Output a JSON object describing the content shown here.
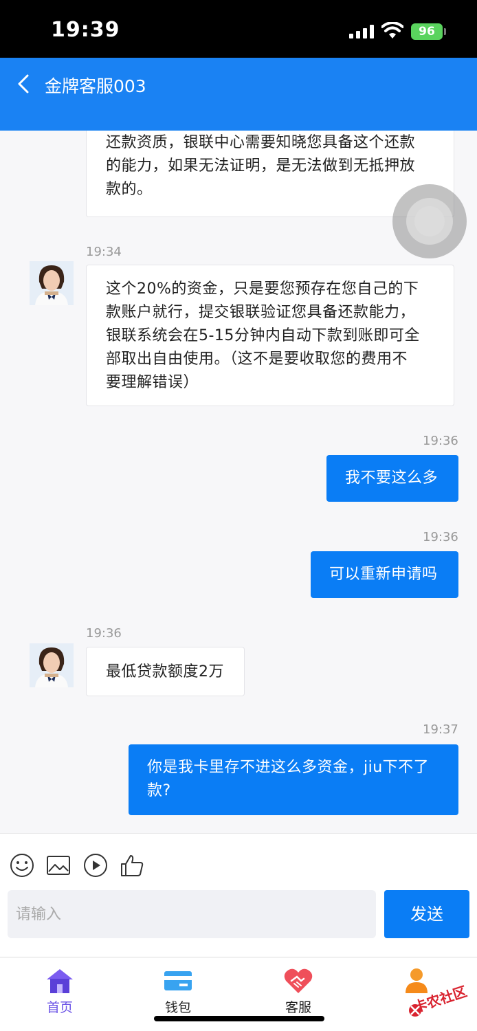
{
  "status_bar": {
    "time": "19:39",
    "battery": "96"
  },
  "header": {
    "title": "金牌客服003"
  },
  "messages": [
    {
      "side": "in",
      "time": "",
      "lines": [
        "还款资质，银联中心需要知晓您具备这个还款",
        "的能力，如果无法证明，是无法做到无抵押放",
        "款的。"
      ]
    },
    {
      "side": "in",
      "time": "19:34",
      "lines": [
        "这个20%的资金，只是要您预存在您自己的下",
        "款账户就行，提交银联验证您具备还款能力，",
        "银联系统会在5-15分钟内自动下款到账即可全",
        "部取出自由使用。（这不是要收取您的费用不",
        "要理解错误）"
      ]
    },
    {
      "side": "out",
      "time": "19:36",
      "lines": [
        "我不要这么多"
      ]
    },
    {
      "side": "out",
      "time": "19:36",
      "lines": [
        "可以重新申请吗"
      ]
    },
    {
      "side": "in",
      "time": "19:36",
      "lines": [
        "最低贷款额度2万"
      ]
    },
    {
      "side": "out",
      "time": "19:37",
      "lines": [
        "你是我卡里存不进这么多资金，jiu下不了",
        "款?"
      ]
    }
  ],
  "composer": {
    "placeholder": "请输入",
    "send_label": "发送",
    "tools": [
      "emoji-icon",
      "image-icon",
      "video-icon",
      "thumbs-up-icon"
    ]
  },
  "tabbar": {
    "items": [
      {
        "label": "首页",
        "icon": "home-icon",
        "active": true
      },
      {
        "label": "钱包",
        "icon": "wallet-icon",
        "active": false
      },
      {
        "label": "客服",
        "icon": "handshake-heart-icon",
        "active": false
      },
      {
        "label": "",
        "icon": "profile-icon",
        "active": false
      }
    ]
  },
  "watermark": {
    "text": "卡农社区"
  },
  "colors": {
    "primary": "#1a82f3",
    "bubble_out": "#0a7df5",
    "tab_active": "#6a52e6"
  }
}
